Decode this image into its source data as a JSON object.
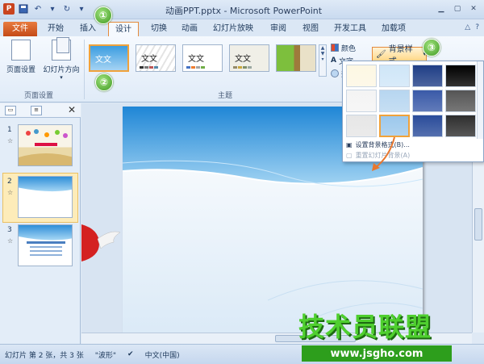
{
  "window": {
    "title": "动画PPT.pptx - Microsoft PowerPoint",
    "app_icon": "P"
  },
  "tabs": [
    "文件",
    "开始",
    "插入",
    "设计",
    "切换",
    "动画",
    "幻灯片放映",
    "审阅",
    "视图",
    "开发工具",
    "加载项"
  ],
  "active_tab": "设计",
  "ribbon": {
    "page_setup": "页面设置",
    "orientation": "幻灯片方向",
    "group_page_setup": "页面设置",
    "group_themes": "主题",
    "theme_sample_text": "文文",
    "colors": "颜色",
    "fonts": "文字",
    "effects": "效果",
    "background_styles": "背景样式"
  },
  "badges": [
    "①",
    "②",
    "③"
  ],
  "dropdown": {
    "item_format_background": "设置背景格式(B)...",
    "item_reset_background": "重置幻灯片背景(A)",
    "swatch_colors": [
      "#fdf7e3",
      "#cfe6f8",
      "#1f3e86",
      "#000000",
      "#f4f4f4",
      "#b7d6f0",
      "#3a5aa8",
      "#555555",
      "#e6e6e6",
      "#9cc8ec",
      "#2a4c9a",
      "#2e2e2e"
    ]
  },
  "left_pane": {
    "slides": [
      "1",
      "2",
      "3"
    ],
    "selected": "2"
  },
  "statusbar": {
    "slide_info": "幻灯片 第 2 张，共 3 张",
    "theme_name": "\"波形\"",
    "language": "中文(中国)"
  },
  "watermark": {
    "title": "技术员联盟",
    "url": "www.jsgho.com"
  }
}
